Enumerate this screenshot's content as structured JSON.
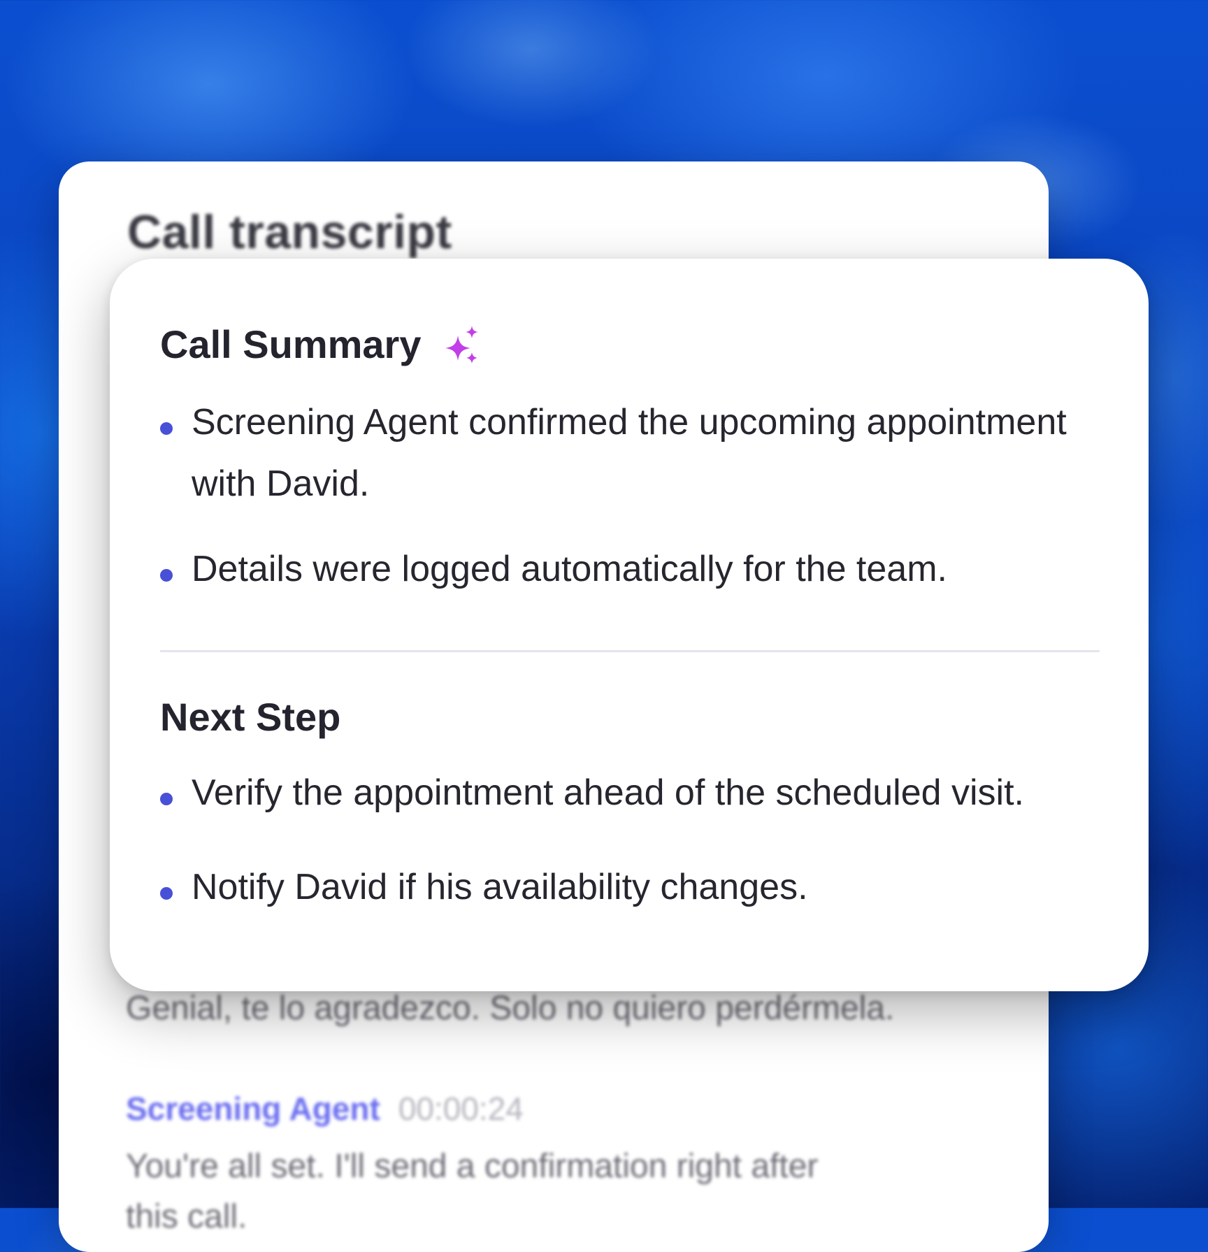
{
  "transcript": {
    "title": "Call transcript",
    "line_1": "Genial, te lo agradezco. Solo no quiero perdérmela.",
    "speaker_name": "Screening Agent",
    "timestamp": "00:00:24",
    "line_2": "You're all set. I'll send a confirmation right after",
    "line_3": "this call."
  },
  "summary": {
    "title": "Call Summary",
    "sparkle_icon": "sparkle-icon",
    "items": [
      "Screening Agent confirmed the upcoming appointment with David.",
      "Details were logged automatically for the team."
    ]
  },
  "next_step": {
    "title": "Next Step",
    "items": [
      "Verify the appointment ahead of the scheduled visit.",
      "Notify David if his availability changes."
    ]
  },
  "colors": {
    "accent_bullet": "#4750d6",
    "speaker": "#6b6ef0",
    "sparkle": "#c23ee8",
    "background": "#0a3fb8"
  }
}
